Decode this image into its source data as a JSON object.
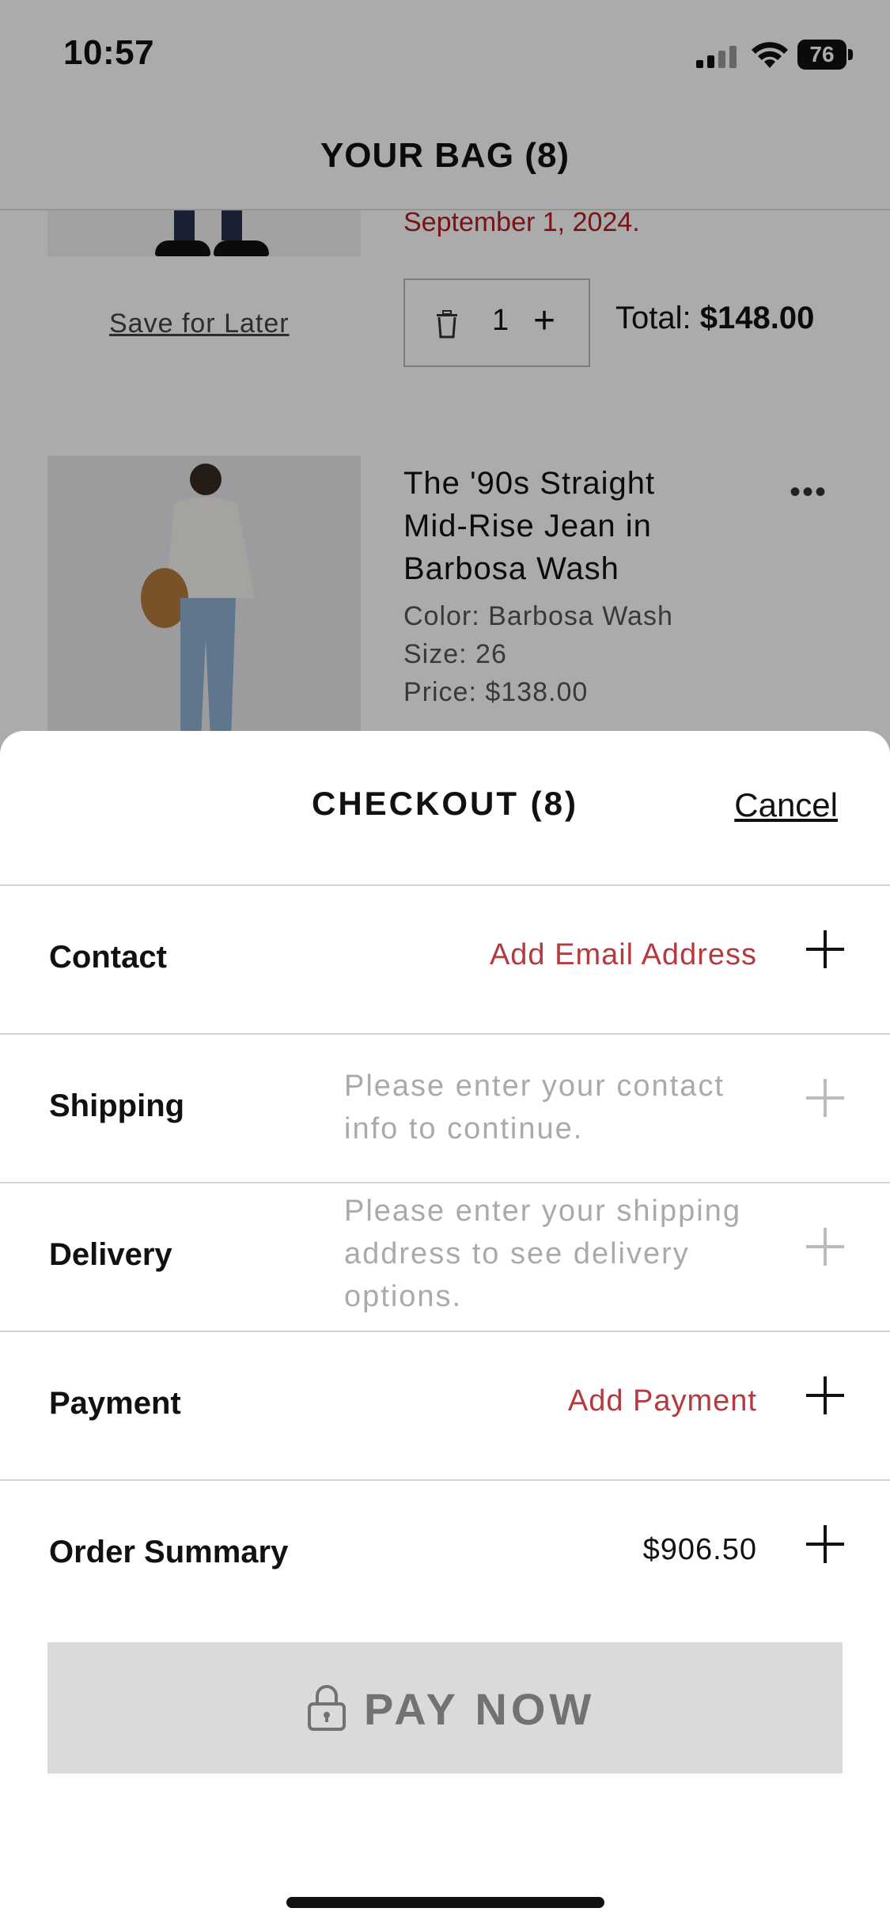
{
  "status_bar": {
    "time": "10:57",
    "battery": "76"
  },
  "bag": {
    "title": "YOUR BAG (8)",
    "item1": {
      "ship_date": "September 1, 2024.",
      "save_for_later": "Save for Later",
      "quantity": "1",
      "total_label": "Total:",
      "total_value": "$148.00"
    },
    "item2": {
      "name": "The '90s Straight Mid-Rise Jean in Barbosa Wash",
      "color": "Color: Barbosa Wash",
      "size": "Size: 26",
      "price": "Price: $138.00"
    }
  },
  "checkout": {
    "title": "CHECKOUT (8)",
    "cancel": "Cancel",
    "rows": [
      {
        "label": "Contact",
        "value": "Add Email Address"
      },
      {
        "label": "Shipping",
        "value": "Please enter your contact info to continue."
      },
      {
        "label": "Delivery",
        "value": "Please enter your shipping address to see delivery options."
      },
      {
        "label": "Payment",
        "value": "Add Payment"
      },
      {
        "label": "Order Summary",
        "value": "$906.50"
      }
    ],
    "pay_now": "PAY NOW"
  },
  "colors": {
    "accent_red": "#b53a3f",
    "disabled_text": "#aaaaaa",
    "button_disabled_bg": "#dadada"
  },
  "icons": [
    "signal-icon",
    "wifi-icon",
    "battery-icon",
    "trash-icon",
    "plus-icon",
    "more-icon",
    "lock-icon"
  ]
}
